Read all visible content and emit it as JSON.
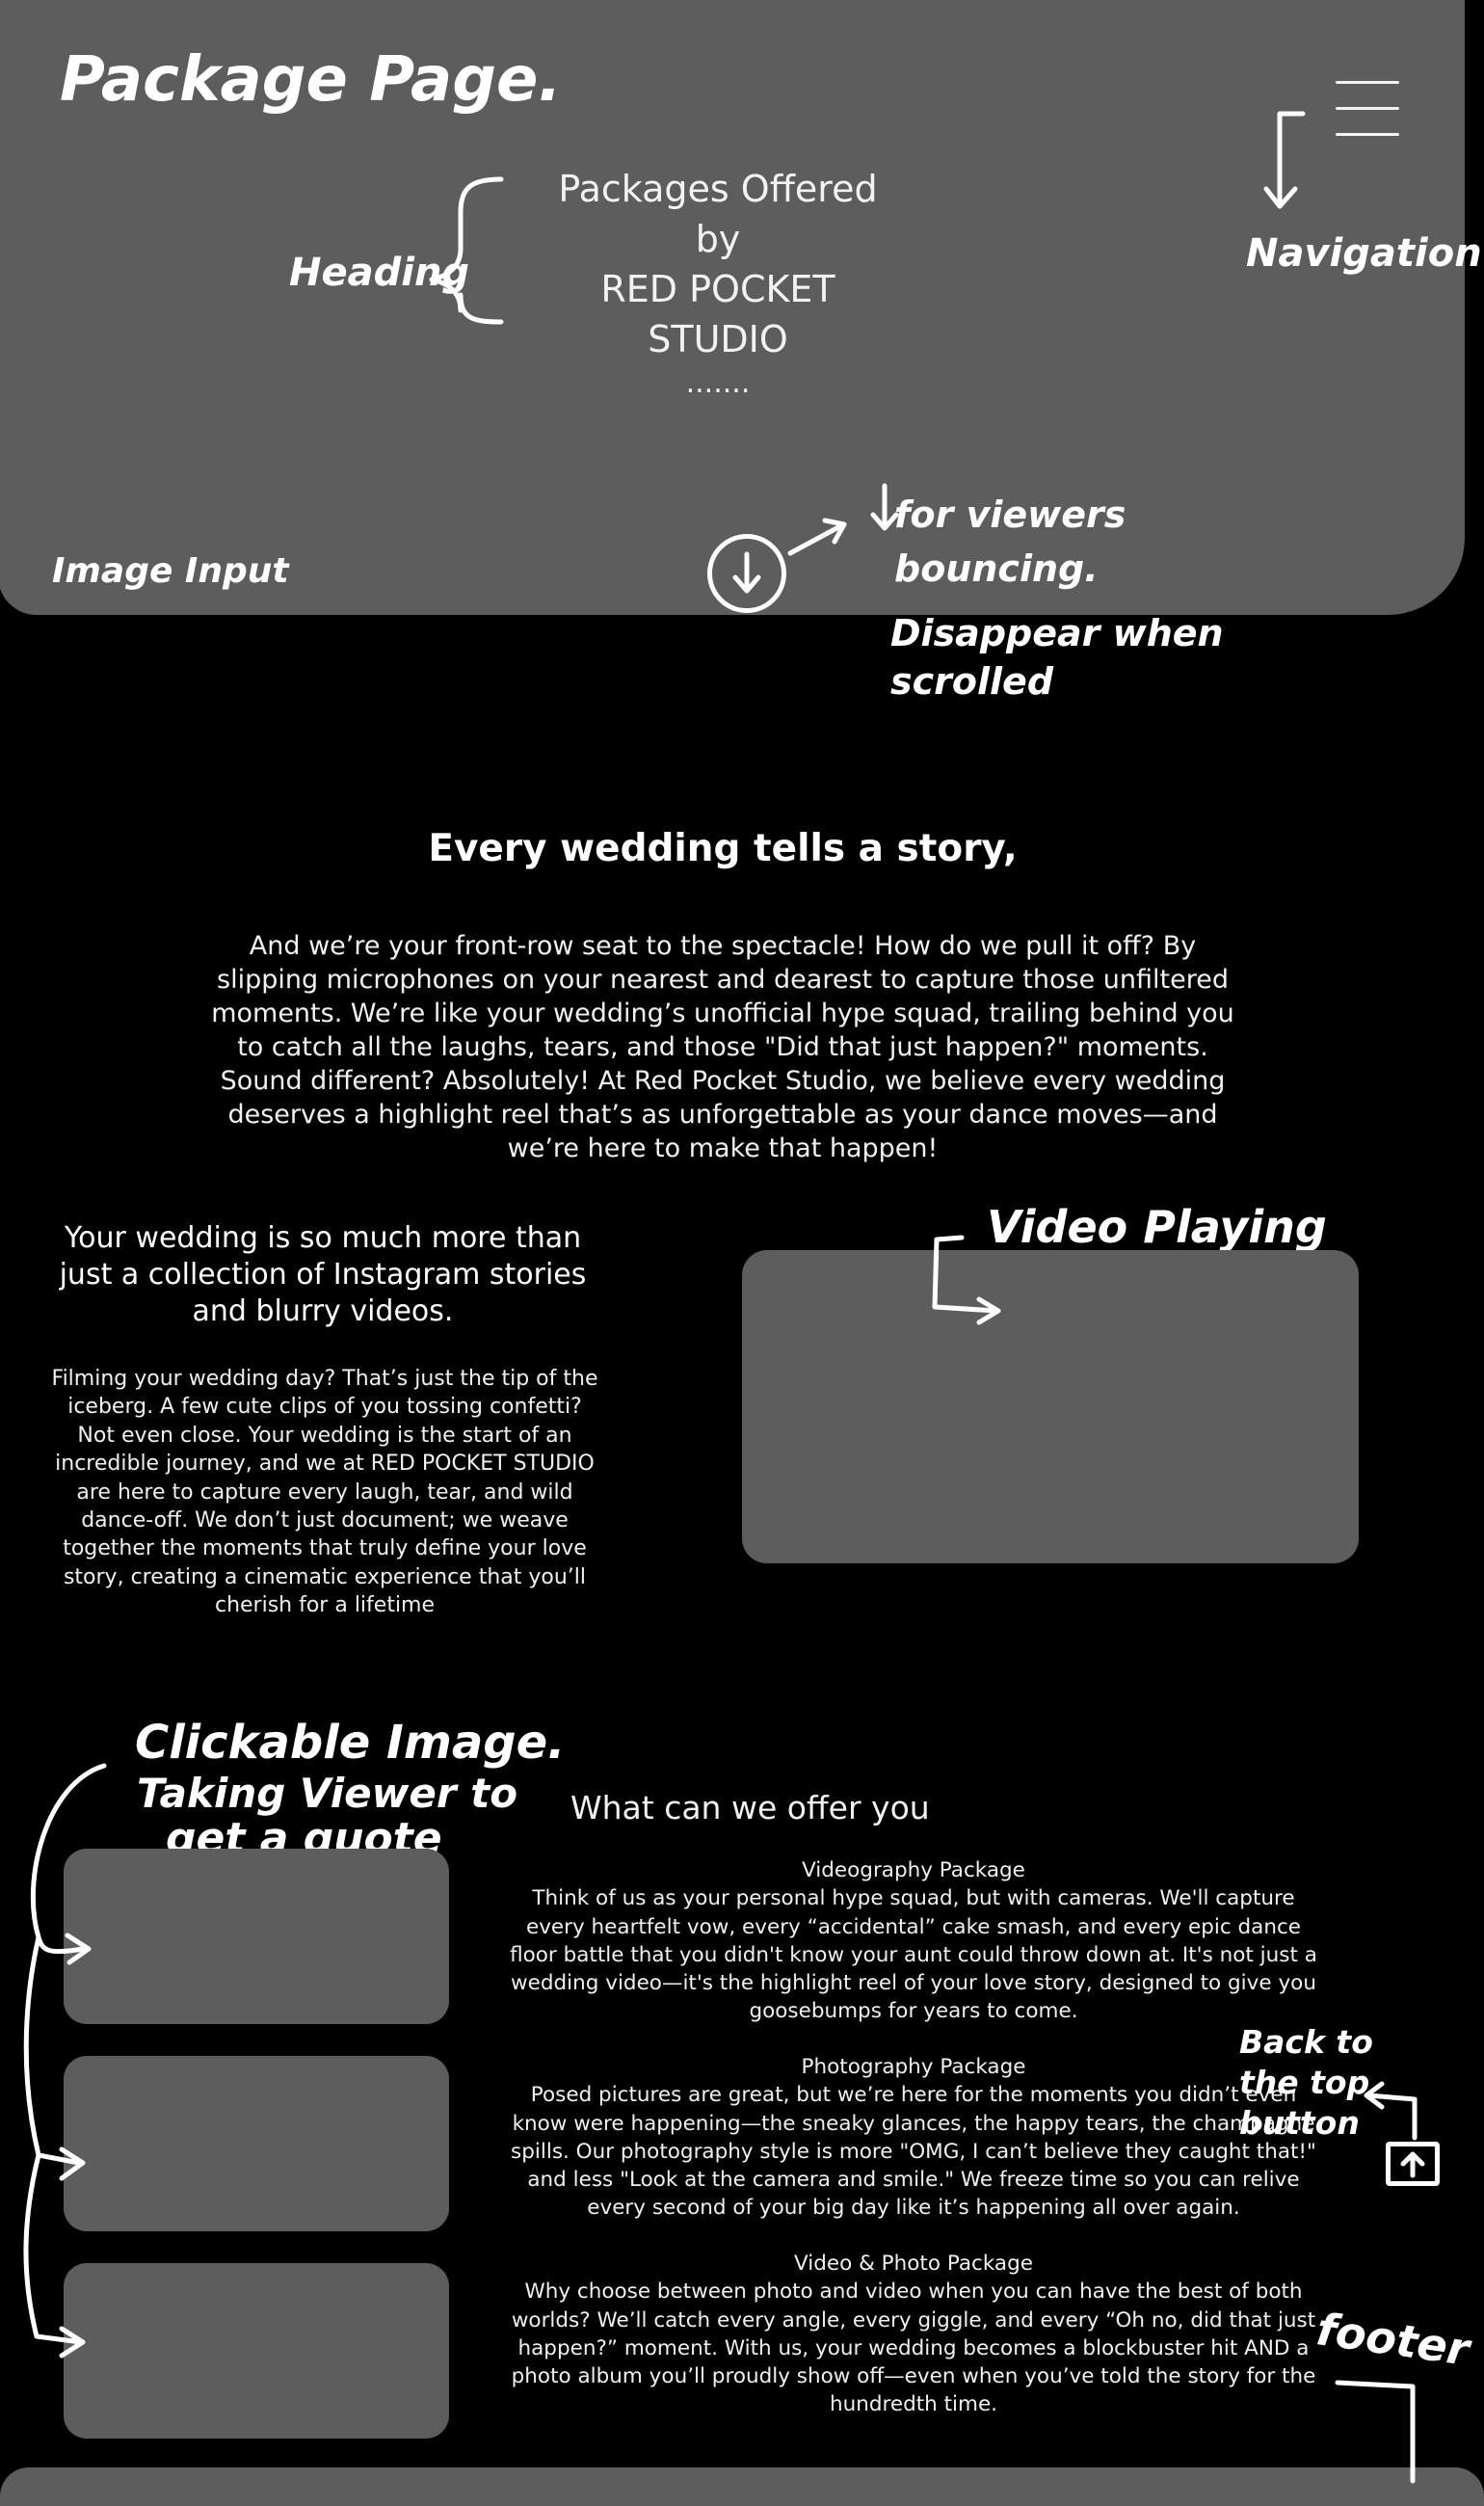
{
  "annotations": {
    "page": "Package Page.",
    "heading": "Heading",
    "navigation": "Navigation",
    "image_input": "Image Input",
    "for_viewers": "for viewers bouncing.",
    "disappear": "Disappear when scrolled",
    "video_playing": "Video Playing",
    "clickable": "Clickable Image.",
    "taking": "Taking Viewer to",
    "get_quote": "get a quote",
    "back_to_top": "Back to the top button",
    "footer": "footer"
  },
  "hero": {
    "title_line1": "Packages Offered by",
    "title_line2": "RED POCKET STUDIO",
    "dots": "......."
  },
  "intro": {
    "heading": "Every wedding tells a story,",
    "paragraph": "And we’re your front-row seat to the spectacle! How do we pull it off? By slipping microphones on your nearest and dearest to capture those unfiltered moments. We’re like your wedding’s unofficial hype squad, trailing behind you to catch all the laughs, tears, and those \"Did that just happen?\" moments.\nSound different? Absolutely! At Red Pocket Studio, we believe every wedding deserves a highlight reel that’s as unforgettable as your dance moves—and we’re here to make that happen!"
  },
  "story": {
    "heading": "Your wedding is so much more than just a collection of Instagram stories and blurry videos.",
    "paragraph": "Filming your wedding day? That’s just the tip of the iceberg. A few cute clips of you tossing confetti? Not even close. Your wedding is the start of an incredible journey, and we at RED POCKET STUDIO are here to capture every laugh, tear, and wild dance-off. We don’t just document; we weave together the moments that truly define your love story, creating a cinematic experience that you’ll cherish for a lifetime"
  },
  "offer": {
    "heading": "What can we offer you",
    "packages": [
      {
        "title": "Videography Package",
        "text": "Think of us as your personal hype squad, but with cameras. We'll capture every heartfelt vow, every “accidental” cake smash, and every epic dance floor battle that you didn't know your aunt could throw down at. It's not just a wedding video—it's the highlight reel of your love story, designed to give you goosebumps for years to come."
      },
      {
        "title": "Photography Package",
        "text": "Posed pictures are great, but we’re here for the moments you didn’t even know were happening—the sneaky glances, the happy tears, the champagne spills. Our photography style is more \"OMG, I can’t believe they caught that!\" and less \"Look at the camera and smile.\" We freeze time so you can relive every second of your big day like it’s happening all over again."
      },
      {
        "title": "Video & Photo Package",
        "text": "Why choose between photo and video when you can have the best of both worlds? We’ll catch every angle, every giggle, and every “Oh no, did that just happen?” moment. With us, your wedding becomes a blockbuster hit AND a photo album you’ll proudly show off—even when you’ve told the story for the hundredth time."
      }
    ]
  }
}
